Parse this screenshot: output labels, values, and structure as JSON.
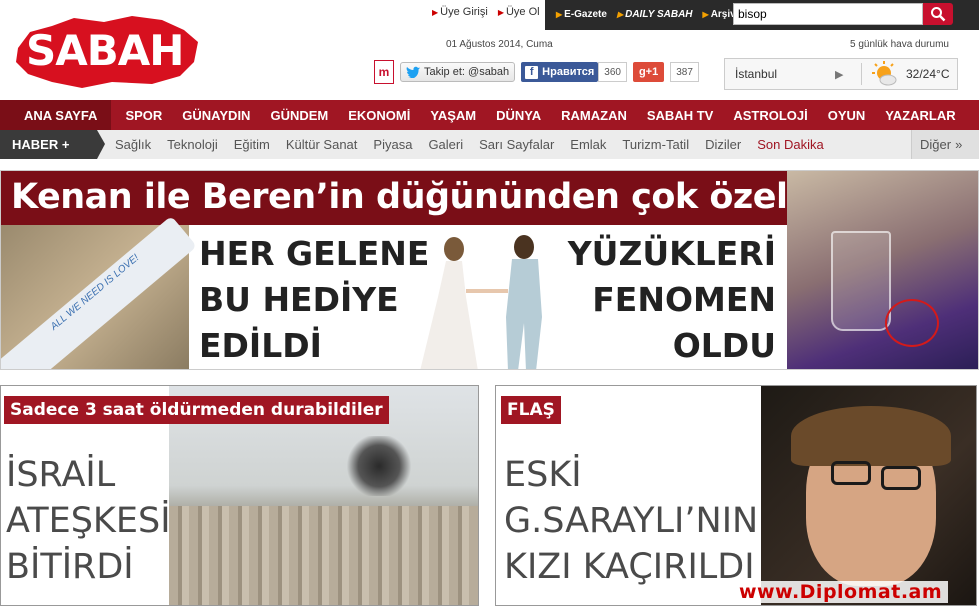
{
  "header": {
    "top_links": [
      {
        "label": "Üye Girişi"
      },
      {
        "label": "Üye Ol"
      }
    ],
    "dark_links": [
      {
        "label": "E-Gazete"
      },
      {
        "label": "DAILY SABAH"
      },
      {
        "label": "Arşiv"
      }
    ],
    "search_value": "bisop",
    "logo_text": "SABAH",
    "date": "01 Ağustos 2014, Cuma",
    "weather_label": "5 günlük hava durumu",
    "social": {
      "m_label": "m",
      "twitter": "Takip et: @sabah",
      "facebook": "Нравится",
      "facebook_count": "360",
      "gplus": "g+1",
      "gplus_count": "387"
    },
    "weather": {
      "city": "İstanbul",
      "temp": "32/24°C"
    }
  },
  "nav_main": [
    {
      "label": "ANA SAYFA"
    },
    {
      "label": "SPOR"
    },
    {
      "label": "GÜNAYDIN"
    },
    {
      "label": "GÜNDEM"
    },
    {
      "label": "EKONOMİ"
    },
    {
      "label": "YAŞAM"
    },
    {
      "label": "DÜNYA"
    },
    {
      "label": "RAMAZAN"
    },
    {
      "label": "SABAH TV"
    },
    {
      "label": "ASTROLOJİ"
    },
    {
      "label": "OYUN"
    },
    {
      "label": "YAZARLAR"
    }
  ],
  "nav_sub": {
    "haber": "HABER +",
    "items": [
      {
        "label": "Sağlık"
      },
      {
        "label": "Teknoloji"
      },
      {
        "label": "Eğitim"
      },
      {
        "label": "Kültür Sanat"
      },
      {
        "label": "Piyasa"
      },
      {
        "label": "Galeri"
      },
      {
        "label": "Sarı Sayfalar"
      },
      {
        "label": "Emlak"
      },
      {
        "label": "Turizm-Tatil"
      },
      {
        "label": "Diziler"
      },
      {
        "label": "Son Dakika"
      }
    ],
    "more": "Diğer"
  },
  "banner": {
    "title": "Kenan ile Beren’in düğününden çok özel kareler",
    "left_text": [
      "HER GELENE",
      "BU HEDİYE",
      "EDİLDİ"
    ],
    "right_text": [
      "YÜZÜKLERİ",
      "FENOMEN",
      "OLDU"
    ],
    "pen_text": "ALL WE NEED IS LOVE!"
  },
  "story1": {
    "label": "Sadece 3 saat öldürmeden durabildiler",
    "headline": [
      "İSRAİL",
      "ATEŞKESİ",
      "BİTİRDİ"
    ]
  },
  "story2": {
    "label": "FLAŞ",
    "headline": [
      "ESKİ",
      "G.SARAYLI’NIN",
      "KIZI KAÇIRILDI"
    ]
  },
  "watermark": "www.Diplomat.am"
}
